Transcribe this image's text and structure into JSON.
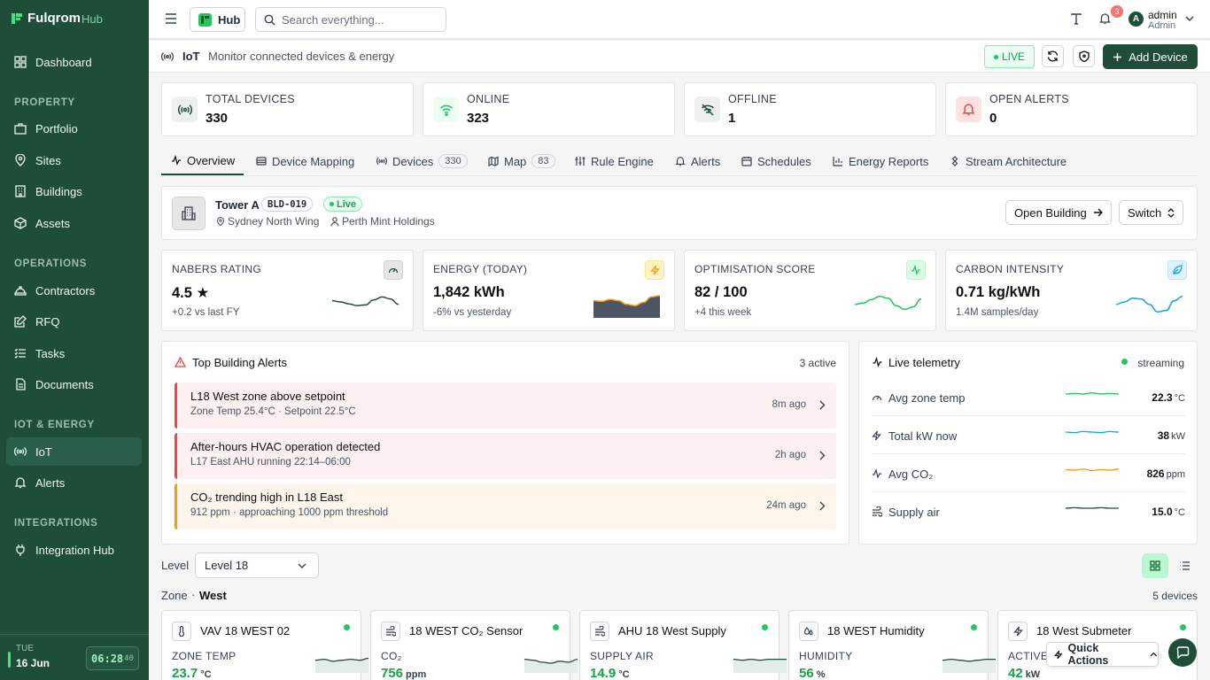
{
  "brand": {
    "name": "Fulqrom",
    "suffix": "Hub"
  },
  "sidebar": {
    "dashboard": "Dashboard",
    "sections": {
      "property": "PROPERTY",
      "operations": "OPERATIONS",
      "iot": "IOT & ENERGY",
      "integrations": "INTEGRATIONS"
    },
    "items": {
      "portfolio": "Portfolio",
      "sites": "Sites",
      "buildings": "Buildings",
      "assets": "Assets",
      "contractors": "Contractors",
      "rfq": "RFQ",
      "tasks": "Tasks",
      "documents": "Documents",
      "iot": "IoT",
      "alerts": "Alerts",
      "integration_hub": "Integration Hub"
    },
    "footer": {
      "day": "TUE",
      "date": "16 Jun",
      "time": "06:28",
      "seconds": "40"
    }
  },
  "topbar": {
    "hub_label": "Hub",
    "search_placeholder": "Search everything...",
    "notifications": "3",
    "user_initial": "A",
    "user_name": "admin",
    "user_role": "Admin"
  },
  "subheader": {
    "title": "IoT",
    "subtitle": "Monitor connected devices & energy",
    "live": "LIVE",
    "add_device": "Add Device"
  },
  "stats": [
    {
      "label": "TOTAL DEVICES",
      "value": "330"
    },
    {
      "label": "ONLINE",
      "value": "323"
    },
    {
      "label": "OFFLINE",
      "value": "1"
    },
    {
      "label": "OPEN ALERTS",
      "value": "0"
    }
  ],
  "tabs": {
    "overview": "Overview",
    "mapping": "Device Mapping",
    "devices": "Devices",
    "devices_count": "330",
    "map": "Map",
    "map_count": "83",
    "rules": "Rule Engine",
    "alerts": "Alerts",
    "schedules": "Schedules",
    "energy": "Energy Reports",
    "stream": "Stream Architecture"
  },
  "building": {
    "name": "Tower A",
    "code": "BLD-019",
    "status": "Live",
    "location": "Sydney North Wing",
    "owner": "Perth Mint Holdings",
    "open": "Open Building",
    "switch": "Switch"
  },
  "kpis": [
    {
      "label": "NABERS RATING",
      "value": "4.5 ★",
      "sub": "+0.2 vs last FY",
      "trend": [
        0.55,
        0.5,
        0.42,
        0.35,
        0.38,
        0.58,
        0.7,
        0.62,
        0.4
      ]
    },
    {
      "label": "ENERGY (TODAY)",
      "value": "1,842 kWh",
      "sub": "-6% vs yesterday",
      "trend": [
        0.55,
        0.52,
        0.6,
        0.55,
        0.4,
        0.35,
        0.48,
        0.7,
        0.75
      ]
    },
    {
      "label": "OPTIMISATION SCORE",
      "value": "82 / 100",
      "sub": "+4 this week",
      "trend": [
        0.4,
        0.45,
        0.6,
        0.72,
        0.65,
        0.35,
        0.2,
        0.3,
        0.62
      ]
    },
    {
      "label": "CARBON INTENSITY",
      "value": "0.71 kg/kWh",
      "sub": "1.4M samples/day",
      "trend": [
        0.4,
        0.5,
        0.65,
        0.62,
        0.4,
        0.1,
        0.15,
        0.55,
        0.72
      ]
    }
  ],
  "alerts_panel": {
    "title": "Top Building Alerts",
    "count": "3 active",
    "items": [
      {
        "title": "L18 West zone above setpoint",
        "detail": "Zone Temp 25.4°C · Setpoint 22.5°C",
        "time": "8m ago",
        "severity": "critical"
      },
      {
        "title": "After-hours HVAC operation detected",
        "detail": "L17 East AHU running 22:14–06:00",
        "time": "2h ago",
        "severity": "critical"
      },
      {
        "title": "CO₂ trending high in L18 East",
        "detail": "912 ppm · approaching 1000 ppm threshold",
        "time": "24m ago",
        "severity": "warning"
      }
    ]
  },
  "telemetry": {
    "title": "Live telemetry",
    "status": "streaming",
    "rows": [
      {
        "label": "Avg zone temp",
        "value": "22.3",
        "unit": "°C",
        "color": "#22c55e"
      },
      {
        "label": "Total kW now",
        "value": "38",
        "unit": "kW",
        "color": "#0ea5e9"
      },
      {
        "label": "Avg CO₂",
        "value": "826",
        "unit": "ppm",
        "color": "#f59e0b"
      },
      {
        "label": "Supply air",
        "value": "15.0",
        "unit": "°C",
        "color": "#1e4e38"
      }
    ]
  },
  "level": {
    "label": "Level",
    "selected": "Level 18"
  },
  "zone": {
    "prefix": "Zone",
    "name": "West",
    "count": "5 devices"
  },
  "devices": [
    {
      "name": "VAV 18 WEST 02",
      "metric": "ZONE TEMP",
      "value": "23.7",
      "unit": "°C"
    },
    {
      "name": "18 WEST CO₂ Sensor",
      "metric": "CO₂",
      "value": "756",
      "unit": "ppm"
    },
    {
      "name": "AHU 18 West Supply",
      "metric": "SUPPLY AIR",
      "value": "14.9",
      "unit": "°C"
    },
    {
      "name": "18 WEST Humidity",
      "metric": "HUMIDITY",
      "value": "56",
      "unit": "%"
    },
    {
      "name": "18 West Submeter",
      "metric": "ACTIVE",
      "value": "42",
      "unit": "kW"
    }
  ],
  "quick_actions": "Quick Actions"
}
